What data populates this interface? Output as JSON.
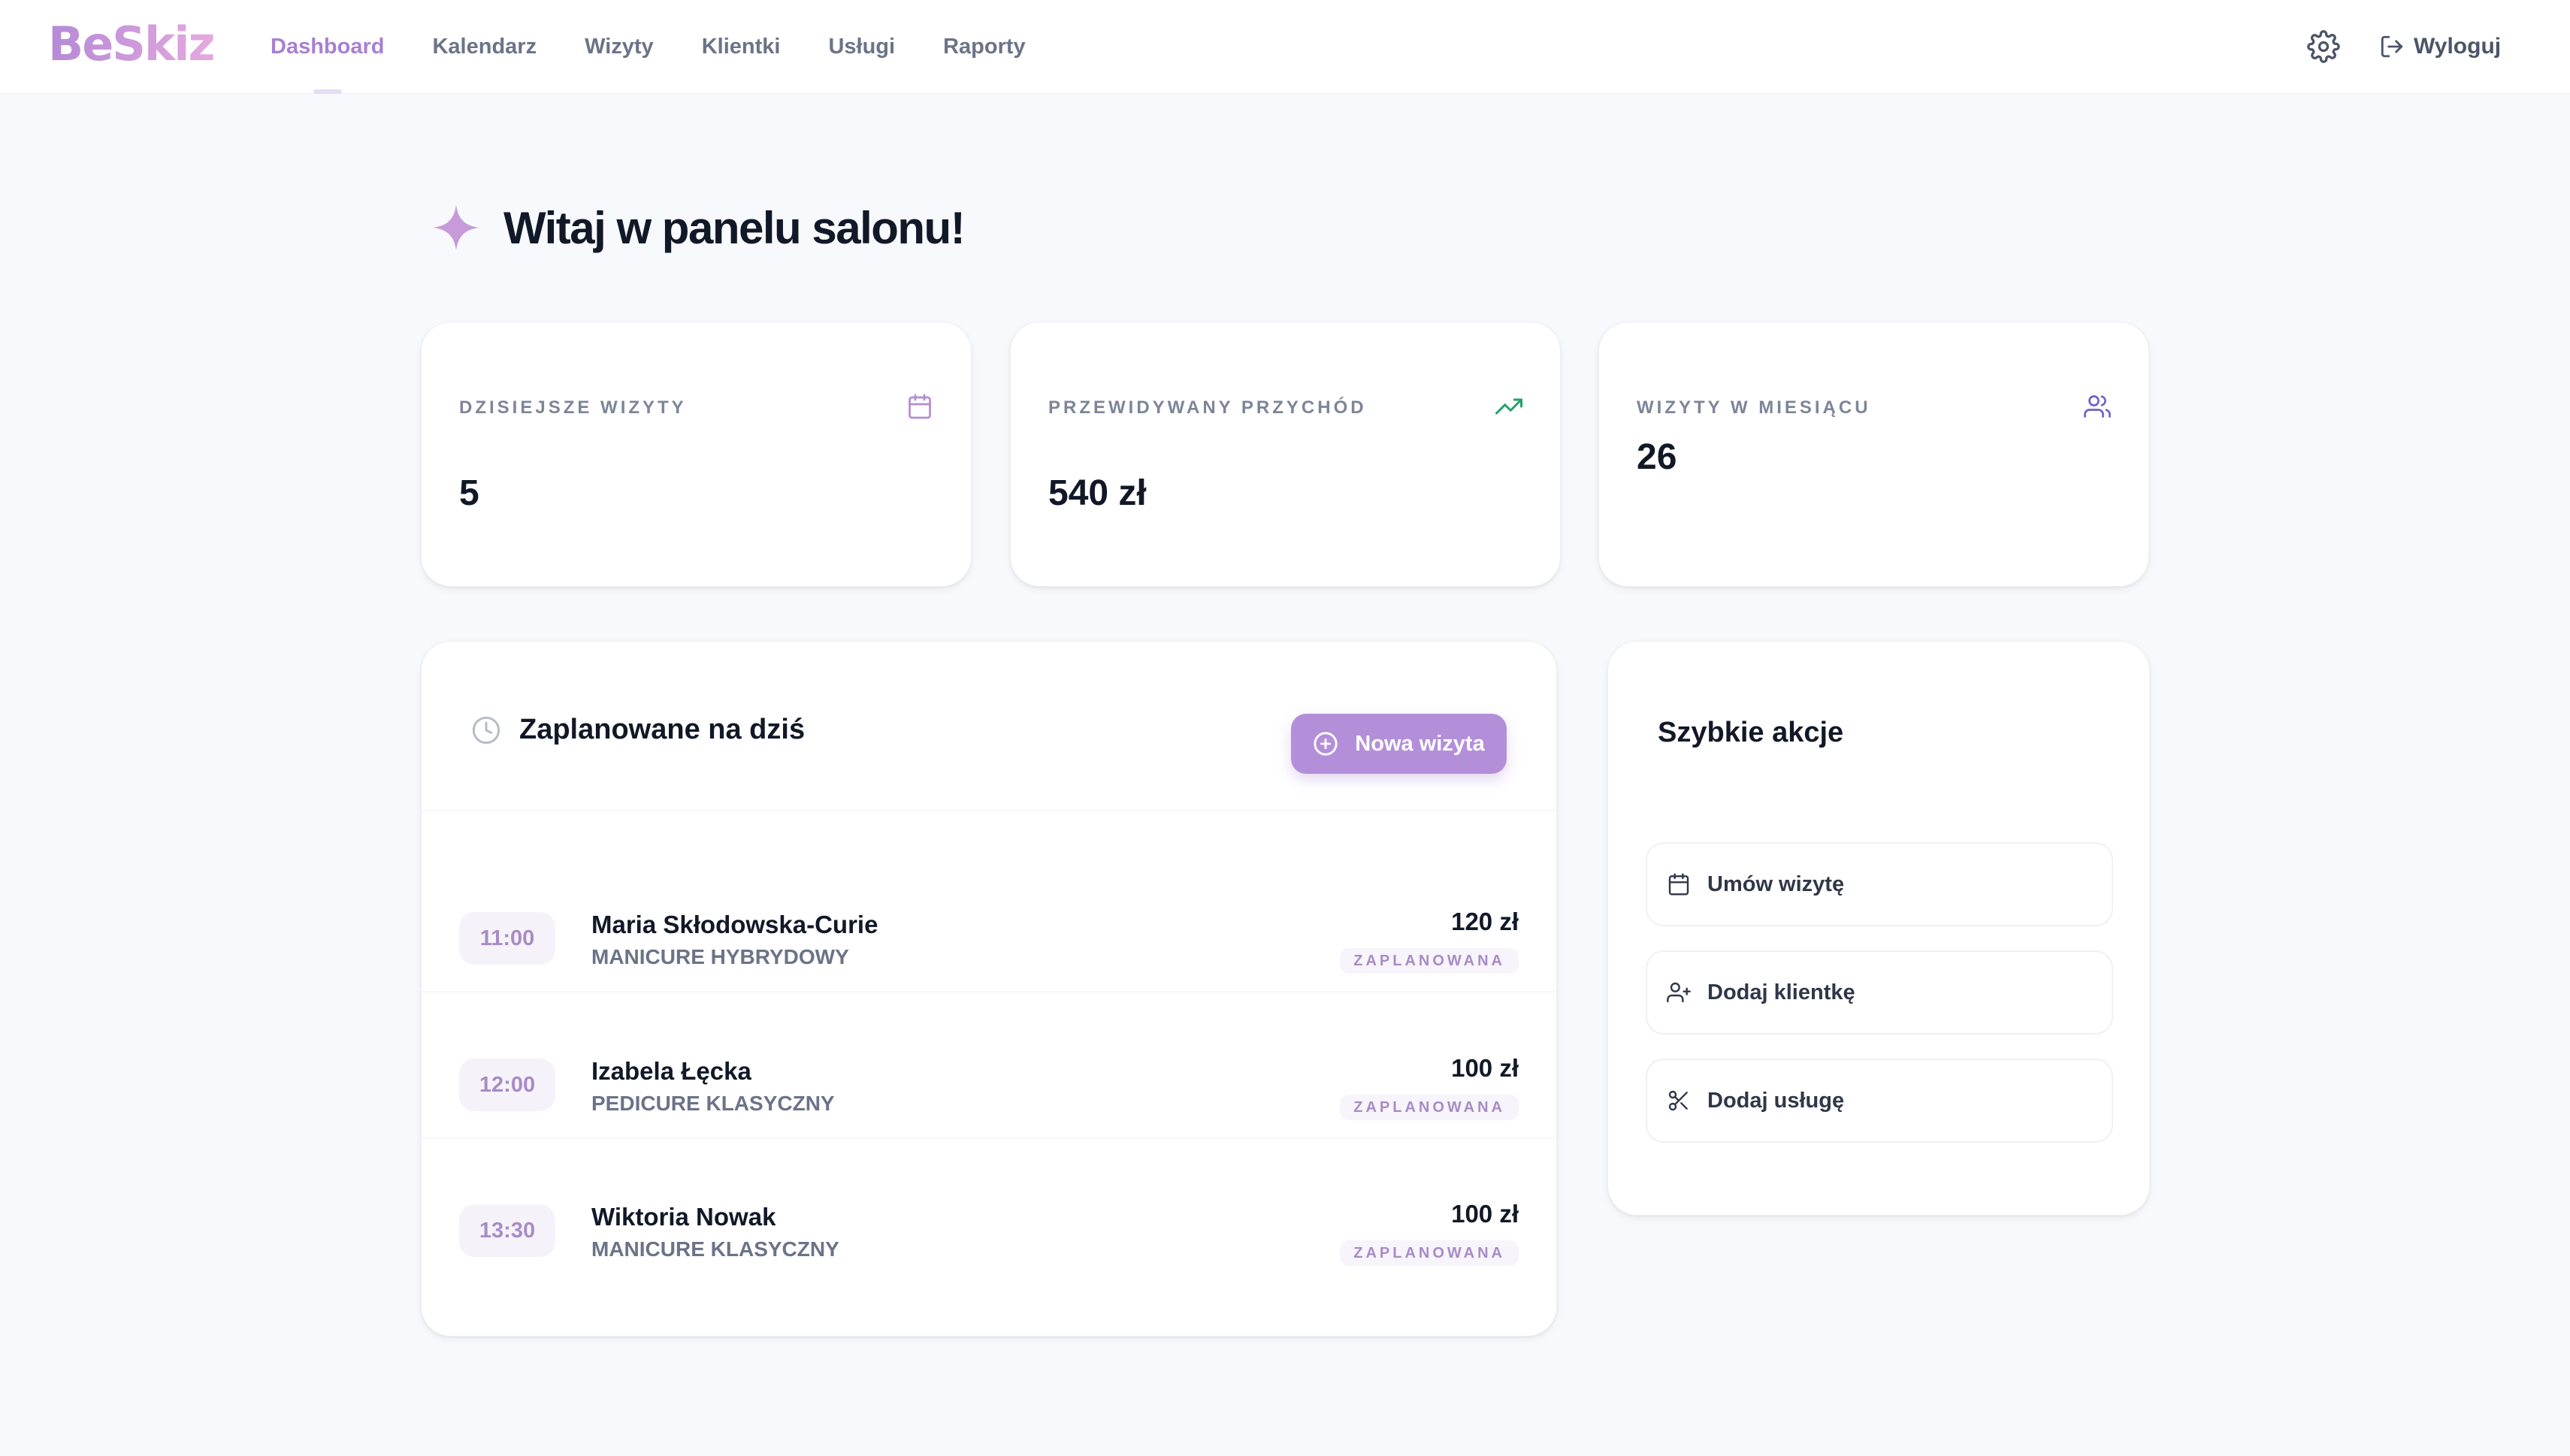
{
  "brand": {
    "logo_text": "BeSkiz"
  },
  "nav": {
    "items": [
      {
        "label": "Dashboard",
        "active": true
      },
      {
        "label": "Kalendarz",
        "active": false
      },
      {
        "label": "Wizyty",
        "active": false
      },
      {
        "label": "Klientki",
        "active": false
      },
      {
        "label": "Usługi",
        "active": false
      },
      {
        "label": "Raporty",
        "active": false
      }
    ],
    "settings_icon": "gear-icon",
    "logout_label": "Wyloguj",
    "logout_icon": "logout-icon"
  },
  "page": {
    "title": "Witaj w panelu salonu!",
    "title_icon": "sparkle-icon"
  },
  "stats": [
    {
      "label": "DZISIEJSZE WIZYTY",
      "value": "5",
      "icon": "calendar-icon",
      "icon_color": "#b48ad6"
    },
    {
      "label": "PRZEWIDYWANY PRZYCHÓD",
      "value": "540 zł",
      "icon": "trending-up-icon",
      "icon_color": "#22a06b"
    },
    {
      "label": "WIZYTY W MIESIĄCU",
      "value": "26",
      "icon": "users-icon",
      "icon_color": "#6b63c9"
    }
  ],
  "schedule": {
    "title": "Zaplanowane na dziś",
    "icon": "clock-icon",
    "new_button_label": "Nowa wizyta",
    "appointments": [
      {
        "time": "11:00",
        "client": "Maria Skłodowska-Curie",
        "service": "MANICURE HYBRYDOWY",
        "price": "120 zł",
        "status": "ZAPLANOWANA"
      },
      {
        "time": "12:00",
        "client": "Izabela Łęcka",
        "service": "PEDICURE KLASYCZNY",
        "price": "100 zł",
        "status": "ZAPLANOWANA"
      },
      {
        "time": "13:30",
        "client": "Wiktoria Nowak",
        "service": "MANICURE KLASYCZNY",
        "price": "100 zł",
        "status": "ZAPLANOWANA"
      }
    ]
  },
  "quick_actions": {
    "title": "Szybkie akcje",
    "items": [
      {
        "label": "Umów wizytę",
        "icon": "calendar-icon"
      },
      {
        "label": "Dodaj klientkę",
        "icon": "user-plus-icon"
      },
      {
        "label": "Dodaj usługę",
        "icon": "scissors-icon"
      }
    ]
  },
  "colors": {
    "accent": "#b48fd9",
    "nav_active": "#a880cf",
    "background": "#f8f9fc"
  }
}
